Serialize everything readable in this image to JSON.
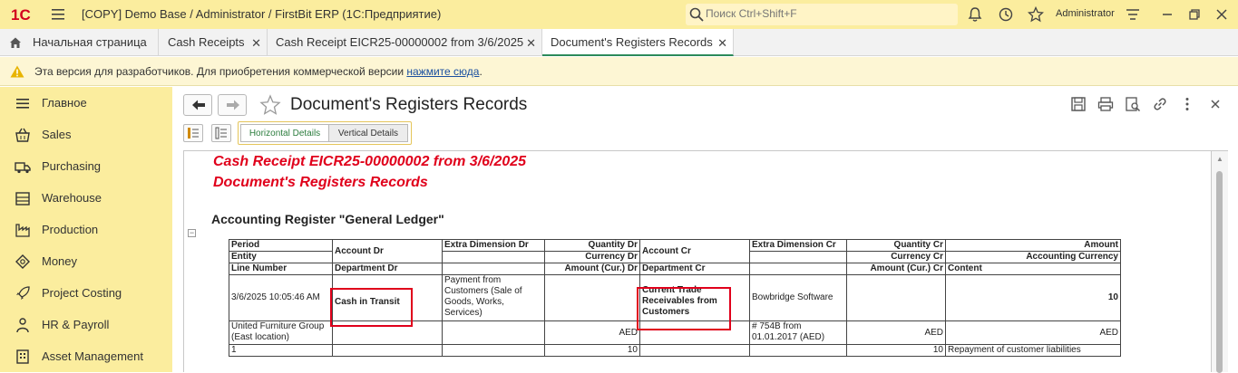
{
  "app": {
    "title": "[COPY] Demo Base / Administrator / FirstBit ERP  (1С:Предприятие)",
    "search_placeholder": "Поиск Ctrl+Shift+F",
    "user": "Administrator",
    "logo": "1С"
  },
  "tabs": [
    {
      "label": "Начальная страница"
    },
    {
      "label": "Cash Receipts"
    },
    {
      "label": "Cash Receipt EICR25-00000002 from 3/6/2025"
    },
    {
      "label": "Document's Registers Records"
    }
  ],
  "warning": {
    "text": "Эта версия для разработчиков. Для приобретения коммерческой версии ",
    "link": "нажмите сюда",
    "suffix": "."
  },
  "sidebar": {
    "items": [
      {
        "label": "Главное",
        "icon": "menu-icon"
      },
      {
        "label": "Sales",
        "icon": "basket-icon"
      },
      {
        "label": "Purchasing",
        "icon": "truck-icon"
      },
      {
        "label": "Warehouse",
        "icon": "warehouse-icon"
      },
      {
        "label": "Production",
        "icon": "production-icon"
      },
      {
        "label": "Money",
        "icon": "money-icon"
      },
      {
        "label": "Project Costing",
        "icon": "rocket-icon"
      },
      {
        "label": "HR & Payroll",
        "icon": "person-icon"
      },
      {
        "label": "Asset Management",
        "icon": "building-icon"
      }
    ]
  },
  "page": {
    "title": "Document's Registers Records",
    "toggle_horizontal": "Horizontal Details",
    "toggle_vertical": "Vertical Details"
  },
  "report": {
    "line1": "Cash Receipt EICR25-00000002 from 3/6/2025",
    "line2": "Document's Registers Records",
    "section": "Accounting Register \"General Ledger\"",
    "headers": {
      "period": "Period",
      "entity": "Entity",
      "line_number": "Line Number",
      "account_dr": "Account Dr",
      "department_dr": "Department Dr",
      "extra_dim_dr": "Extra Dimension Dr",
      "quantity_dr": "Quantity Dr",
      "currency_dr": "Currency Dr",
      "amount_cur_dr": "Amount (Cur.) Dr",
      "account_cr": "Account Cr",
      "department_cr": "Department Cr",
      "extra_dim_cr": "Extra Dimension Cr",
      "quantity_cr": "Quantity Cr",
      "currency_cr": "Currency Cr",
      "amount_cur_cr": "Amount (Cur.) Cr",
      "amount": "Amount",
      "accounting_currency": "Accounting Currency",
      "content": "Content"
    },
    "row": {
      "period": "3/6/2025 10:05:46 AM",
      "entity": "United Furniture Group (East location)",
      "line_number": "1",
      "account_dr": "Cash in Transit",
      "extra_dim_dr": "Payment from Customers (Sale of Goods, Works, Services)",
      "currency_dr": "AED",
      "amount_cur_dr": "10",
      "account_cr": "Current Trade Receivables from Customers",
      "extra_dim_cr_1": "Bowbridge Software",
      "extra_dim_cr_2": "# 754B from 01.01.2017 (AED)",
      "currency_cr": "AED",
      "amount_cur_cr": "10",
      "amount": "10",
      "accounting_currency": "AED",
      "content": "Repayment of customer liabilities"
    }
  },
  "colors": {
    "accent_yellow": "#fbed9e",
    "report_red": "#e0001b",
    "active_tab_green": "#2c8a5a",
    "link_blue": "#1a4fa0"
  }
}
